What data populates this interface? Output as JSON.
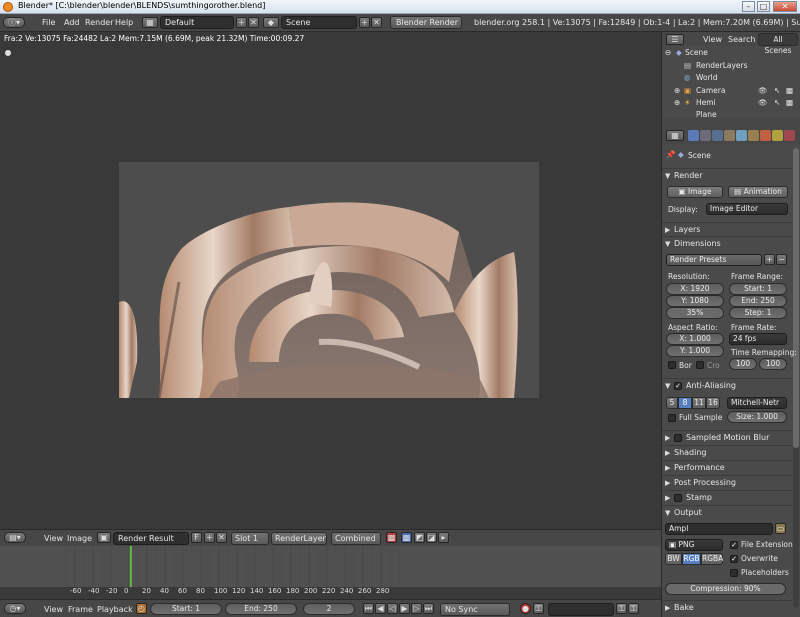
{
  "window": {
    "title": "Blender* [C:\\blender\\blender\\BLENDS\\sumthingorother.blend]",
    "minimize": "–",
    "maximize": "□",
    "close": "✕"
  },
  "info_header": {
    "menus": [
      "File",
      "Add",
      "Render",
      "Help"
    ],
    "screen_layout": "Default",
    "scene": "Scene",
    "render_engine": "Blender Render",
    "stats": "blender.org 258.1 | Ve:13075 | Fa:12849 | Ob:1-4 | La:2 | Mem:7.20M (6.69M) | Sun"
  },
  "image_editor": {
    "render_info": "Fra:2  Ve:13075 Fa:24482 La:2 Mem:7.15M (6.69M, peak 21.32M) Time:00:09.27",
    "header": {
      "menus": [
        "View",
        "Image"
      ],
      "image_name": "Render Result",
      "fake_user": "F",
      "slot": "Slot 1",
      "layer": "RenderLayer",
      "pass": "Combined"
    }
  },
  "timeline": {
    "ticks": [
      "-60",
      "-40",
      "-20",
      "0",
      "20",
      "40",
      "60",
      "80",
      "100",
      "120",
      "140",
      "160",
      "180",
      "200",
      "220",
      "240",
      "260",
      "280"
    ],
    "current_frame_marker": 2,
    "header": {
      "menus": [
        "View",
        "Frame",
        "Playback"
      ],
      "start": "Start: 1",
      "end": "End: 250",
      "current": "2",
      "sync": "No Sync"
    }
  },
  "outliner": {
    "tabs": [
      "View",
      "Search",
      "All Scenes"
    ],
    "items": [
      "Scene",
      "RenderLayers",
      "World",
      "Camera",
      "Hemi",
      "Plane"
    ]
  },
  "properties": {
    "context": "Scene",
    "render_panel": {
      "title": "Render",
      "image_button": "Image",
      "animation_button": "Animation",
      "display_label": "Display:",
      "display_value": "Image Editor"
    },
    "layers_panel": "Layers",
    "dimensions_panel": {
      "title": "Dimensions",
      "presets": "Render Presets",
      "resolution_label": "Resolution:",
      "res_x": "X: 1920",
      "res_y": "Y: 1080",
      "res_pct": "35%",
      "frame_range_label": "Frame Range:",
      "start": "Start: 1",
      "end": "End: 250",
      "step": "Step: 1",
      "aspect_label": "Aspect Ratio:",
      "aspect_x": "X: 1.000",
      "aspect_y": "Y: 1.000",
      "frame_rate_label": "Frame Rate:",
      "fps": "24 fps",
      "time_remap_label": "Time Remapping:",
      "remap_old": "100",
      "remap_new": "100",
      "border_label": "Bor",
      "crop_label": "Cro"
    },
    "aa_panel": {
      "title": "Anti-Aliasing",
      "samples": [
        "5",
        "8",
        "11",
        "16"
      ],
      "selected_sample": "8",
      "filter": "Mitchell-Netr",
      "full_sample_label": "Full Sample",
      "size": "Size: 1.000"
    },
    "collapsed_panels": [
      "Sampled Motion Blur",
      "Shading",
      "Performance",
      "Post Processing",
      "Stamp"
    ],
    "output_panel": {
      "title": "Output",
      "path": "Ampl",
      "format": "PNG",
      "file_extension_label": "File Extension",
      "overwrite_label": "Overwrite",
      "placeholders_label": "Placeholders",
      "color_modes": [
        "BW",
        "RGB",
        "RGBA"
      ],
      "selected_color_mode": "RGB",
      "compression": "Compression: 90%"
    },
    "bake_panel": "Bake"
  }
}
